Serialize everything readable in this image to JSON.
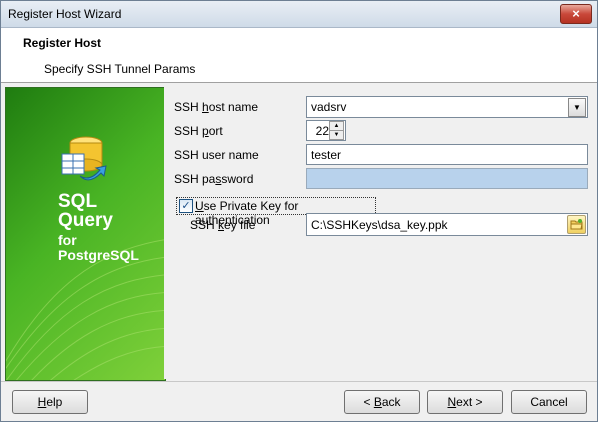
{
  "window": {
    "title": "Register Host Wizard",
    "close_label": "×"
  },
  "header": {
    "title": "Register Host",
    "subtitle": "Specify SSH Tunnel Params"
  },
  "banner": {
    "line1": "SQL",
    "line2": "Query",
    "line3": "for",
    "line4": "PostgreSQL",
    "icon": "database-arrow-icon"
  },
  "form": {
    "host": {
      "label_pre": "SSH ",
      "label_u": "h",
      "label_post": "ost name",
      "value": "vadsrv"
    },
    "port": {
      "label_pre": "SSH ",
      "label_u": "p",
      "label_post": "ort",
      "value": "22"
    },
    "user": {
      "label": "SSH user name",
      "value": "tester"
    },
    "password": {
      "label_pre": "SSH pa",
      "label_u": "s",
      "label_post": "sword",
      "value": ""
    },
    "use_private_key": {
      "label_u": "U",
      "label_post": "se Private Key for authentication",
      "checked": true,
      "check_glyph": "✓"
    },
    "key_file": {
      "label_pre": "SSH ",
      "label_u": "k",
      "label_post": "ey file",
      "value": "C:\\SSHKeys\\dsa_key.ppk"
    }
  },
  "footer": {
    "help": {
      "u": "H",
      "rest": "elp"
    },
    "back": {
      "pre": "< ",
      "u": "B",
      "rest": "ack"
    },
    "next": {
      "u": "N",
      "rest": "ext >"
    },
    "cancel": "Cancel"
  }
}
